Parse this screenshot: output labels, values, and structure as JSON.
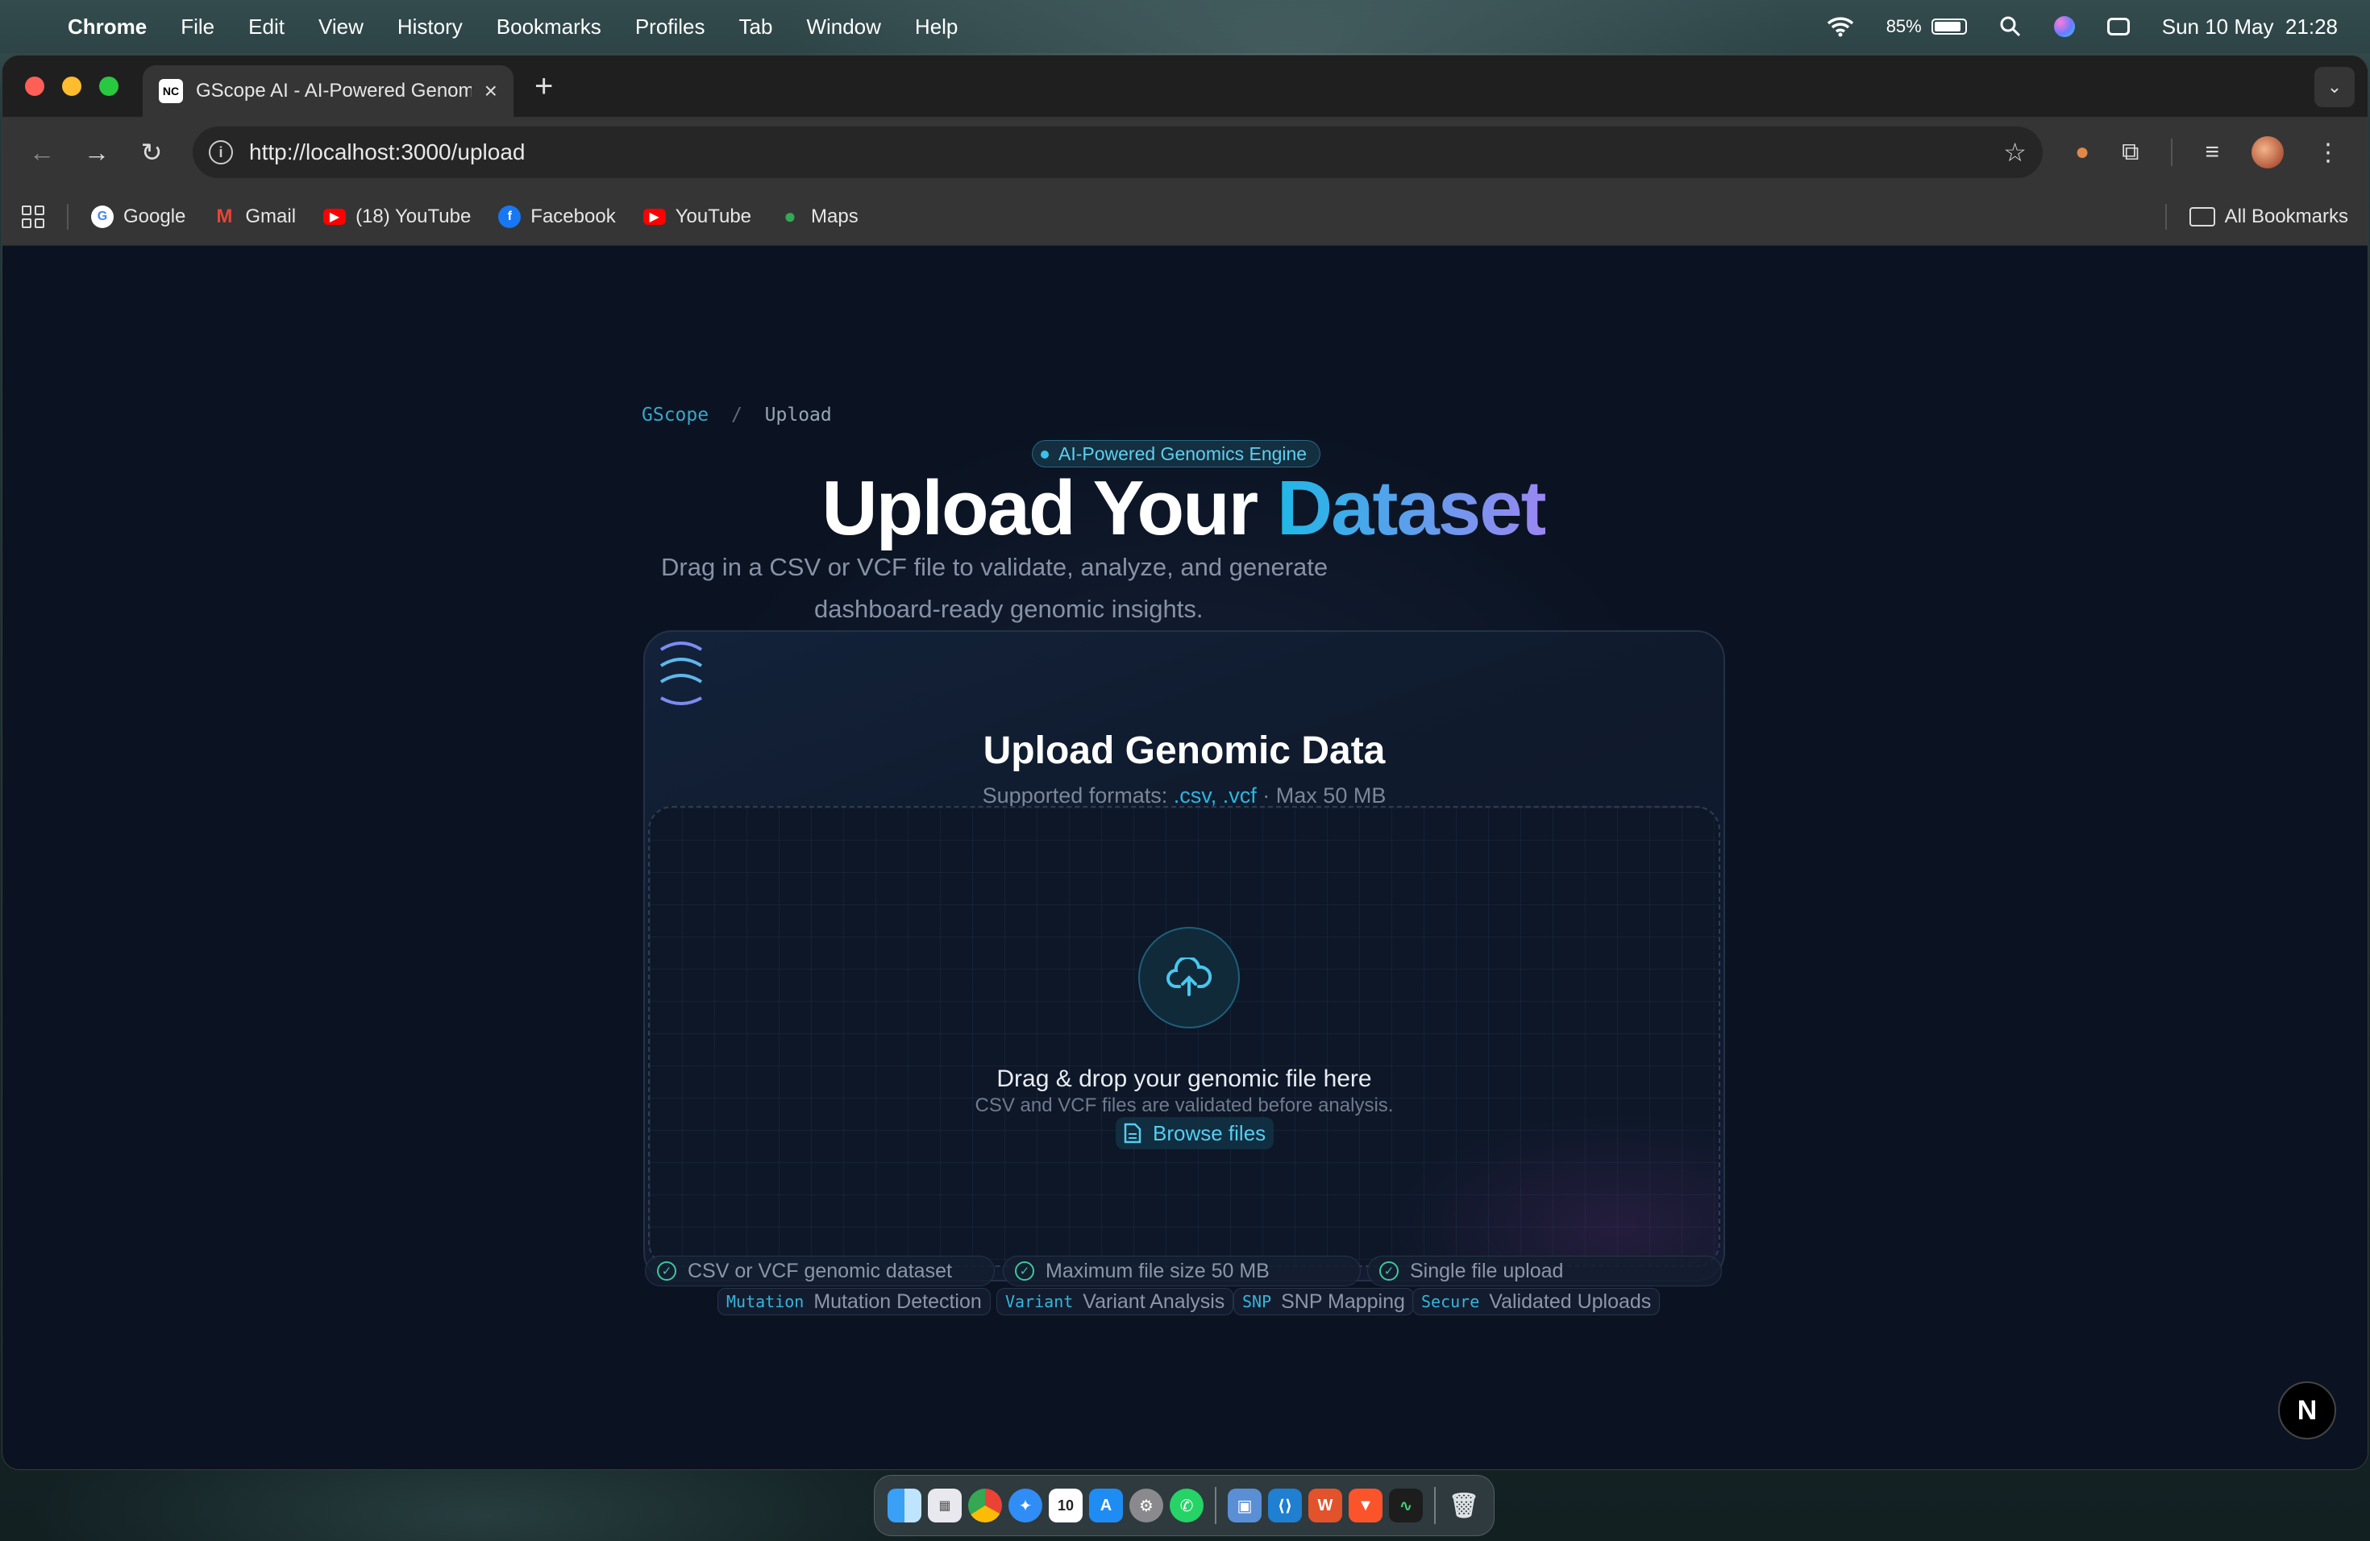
{
  "menubar": {
    "app_name": "Chrome",
    "items": [
      "File",
      "Edit",
      "View",
      "History",
      "Bookmarks",
      "Profiles",
      "Tab",
      "Window",
      "Help"
    ],
    "battery": "85%",
    "datetime": "Sun 10 May  21:28"
  },
  "browser": {
    "tab_title": "GScope AI - AI-Powered Genomics",
    "tab_favicon": "NC",
    "url": "http://localhost:3000/upload",
    "bookmarks": [
      {
        "label": "Google",
        "icon": "google-icon",
        "color": "#4285f4"
      },
      {
        "label": "Gmail",
        "icon": "gmail-icon",
        "color": "#ea4335"
      },
      {
        "label": "(18) YouTube",
        "icon": "youtube-icon",
        "color": "#ff0000"
      },
      {
        "label": "Facebook",
        "icon": "facebook-icon",
        "color": "#1877f2"
      },
      {
        "label": "YouTube",
        "icon": "youtube-icon",
        "color": "#ff0000"
      },
      {
        "label": "Maps",
        "icon": "maps-icon",
        "color": "#34a853"
      }
    ],
    "all_bookmarks": "All Bookmarks"
  },
  "page": {
    "breadcrumb_root": "GScope",
    "breadcrumb_sep": "/",
    "breadcrumb_current": "Upload",
    "pill": "AI-Powered Genomics Engine",
    "headline_part1": "Upload Your ",
    "headline_part2": "Dataset",
    "subtitle_line1": "Drag in a CSV or VCF file to validate, analyze, and generate",
    "subtitle_line2": "dashboard-ready genomic insights.",
    "card": {
      "title": "Upload Genomic Data",
      "formats_prefix": "Supported formats: ",
      "formats": ".csv, .vcf",
      "formats_suffix": " · Max 50 MB",
      "dropzone_title": "Drag & drop your genomic file here",
      "dropzone_sub": "CSV and VCF files are validated before analysis.",
      "browse": "Browse files"
    },
    "requirements": [
      "CSV or VCF genomic dataset",
      "Maximum file size 50 MB",
      "Single file upload"
    ],
    "tags": [
      {
        "code": "Mutation",
        "label": "Mutation Detection"
      },
      {
        "code": "Variant",
        "label": "Variant Analysis"
      },
      {
        "code": "SNP",
        "label": "SNP Mapping"
      },
      {
        "code": "Secure",
        "label": "Validated Uploads"
      }
    ],
    "next_badge": "N"
  },
  "colors": {
    "accent_cyan": "#2cb6e0",
    "accent_violet": "#9b86f2",
    "success": "#3fc79a",
    "page_bg": "#0b1322"
  }
}
